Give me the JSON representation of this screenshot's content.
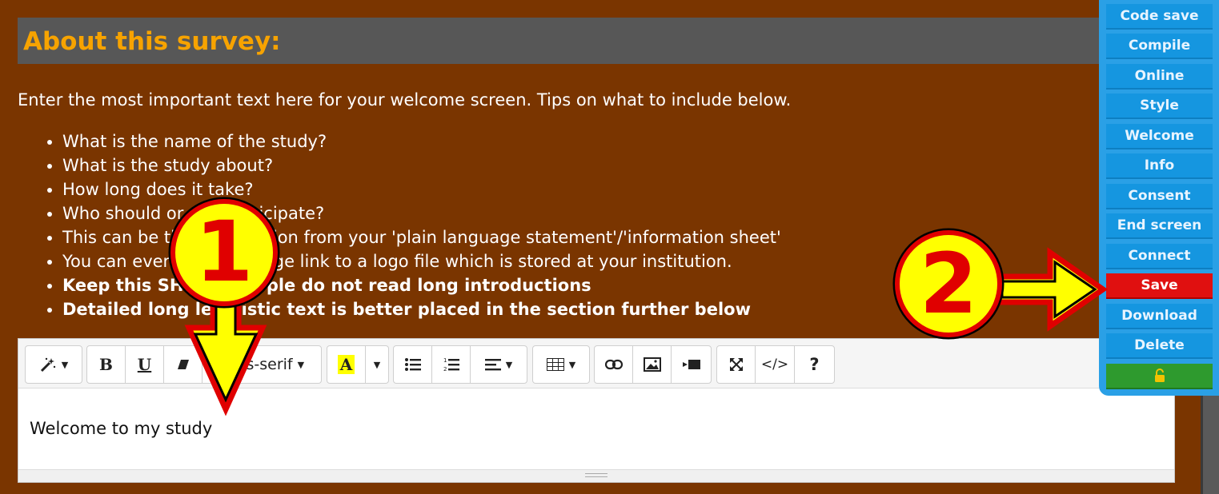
{
  "section": {
    "title": "About this survey:",
    "intro": "Enter the most important text here for your welcome screen. Tips on what to include below.",
    "tips": [
      "What is the name of the study?",
      "What is the study about?",
      "How long does it take?",
      "Who should or can participate?",
      "This can be the introduction from your 'plain language statement'/'information sheet'",
      "You can even add an image link to a logo file which is stored at your institution."
    ],
    "bold_tips": [
      "Keep this SHORT, people do not read long introductions",
      "Detailed long legalistic text is better placed in the section further below"
    ]
  },
  "toolbar": {
    "font_name": "sans-serif",
    "bold": "B",
    "underline": "U",
    "highlight": "A",
    "code": "</>",
    "help": "?"
  },
  "editor": {
    "content": "Welcome to my study"
  },
  "sidebar": {
    "buttons": [
      "Code save",
      "Compile",
      "Online",
      "Style",
      "Welcome",
      "Info",
      "Consent",
      "End screen",
      "Connect",
      "Save",
      "Download",
      "Delete"
    ],
    "lock_icon": "lock-open-icon"
  },
  "annotations": {
    "step1": "1",
    "step2": "2"
  },
  "colors": {
    "background": "#7a3500",
    "title": "#f7a300",
    "sidebar": "#2aa0e6",
    "save": "#e01010",
    "marker_yellow": "#ffff00",
    "marker_red": "#e00000"
  }
}
